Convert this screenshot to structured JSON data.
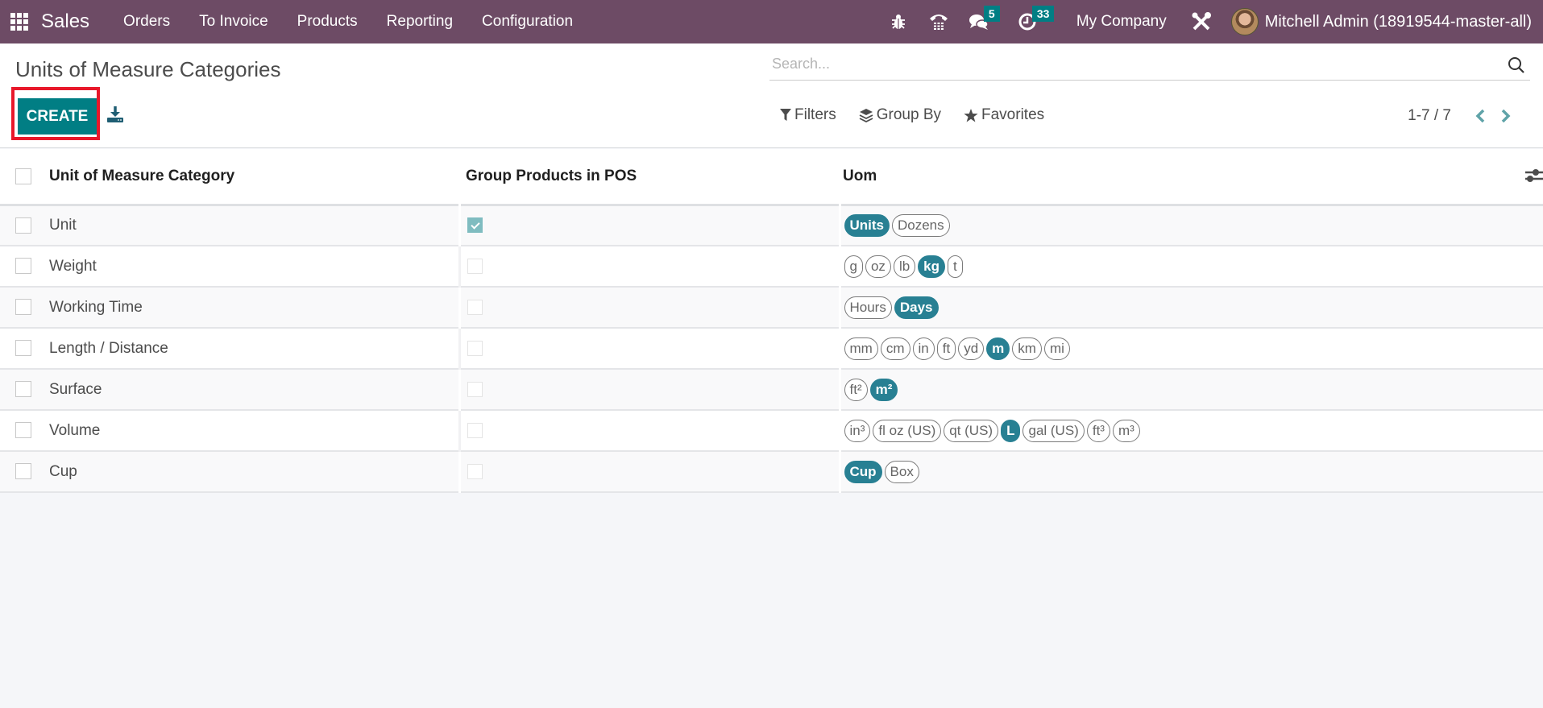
{
  "navbar": {
    "app_name": "Sales",
    "menu": [
      "Orders",
      "To Invoice",
      "Products",
      "Reporting",
      "Configuration"
    ],
    "icons": {
      "apps": "apps-grid-icon",
      "debug": "bug-icon",
      "phone": "phone-icon",
      "messages": "chat-icon",
      "activities": "clock-icon",
      "settings": "tools-icon"
    },
    "messages_count": "5",
    "activities_count": "33",
    "company": "My Company",
    "user": "Mitchell Admin (18919544-master-all)",
    "badge_color": "#017e84",
    "bar_color": "#6d4b65"
  },
  "control_panel": {
    "title": "Units of Measure Categories",
    "create_label": "CREATE",
    "create_highlight_color": "#e8182a",
    "search_placeholder": "Search...",
    "filters_label": "Filters",
    "group_by_label": "Group By",
    "favorites_label": "Favorites",
    "pager_value": "1-7 / 7",
    "accent_color": "#017e84"
  },
  "table": {
    "columns": [
      "Unit of Measure Category",
      "Group Products in POS",
      "Uom"
    ],
    "rows": [
      {
        "name": "Unit",
        "group_pos": true,
        "uoms": [
          {
            "label": "Units",
            "ref": true
          },
          {
            "label": "Dozens",
            "ref": false
          }
        ]
      },
      {
        "name": "Weight",
        "group_pos": false,
        "uoms": [
          {
            "label": "g",
            "ref": false
          },
          {
            "label": "oz",
            "ref": false
          },
          {
            "label": "lb",
            "ref": false
          },
          {
            "label": "kg",
            "ref": true
          },
          {
            "label": "t",
            "ref": false
          }
        ]
      },
      {
        "name": "Working Time",
        "group_pos": false,
        "uoms": [
          {
            "label": "Hours",
            "ref": false
          },
          {
            "label": "Days",
            "ref": true
          }
        ]
      },
      {
        "name": "Length / Distance",
        "group_pos": false,
        "uoms": [
          {
            "label": "mm",
            "ref": false
          },
          {
            "label": "cm",
            "ref": false
          },
          {
            "label": "in",
            "ref": false
          },
          {
            "label": "ft",
            "ref": false
          },
          {
            "label": "yd",
            "ref": false
          },
          {
            "label": "m",
            "ref": true
          },
          {
            "label": "km",
            "ref": false
          },
          {
            "label": "mi",
            "ref": false
          }
        ]
      },
      {
        "name": "Surface",
        "group_pos": false,
        "uoms": [
          {
            "label": "ft²",
            "ref": false
          },
          {
            "label": "m²",
            "ref": true
          }
        ]
      },
      {
        "name": "Volume",
        "group_pos": false,
        "uoms": [
          {
            "label": "in³",
            "ref": false
          },
          {
            "label": "fl oz (US)",
            "ref": false
          },
          {
            "label": "qt (US)",
            "ref": false
          },
          {
            "label": "L",
            "ref": true
          },
          {
            "label": "gal (US)",
            "ref": false
          },
          {
            "label": "ft³",
            "ref": false
          },
          {
            "label": "m³",
            "ref": false
          }
        ]
      },
      {
        "name": "Cup",
        "group_pos": false,
        "uoms": [
          {
            "label": "Cup",
            "ref": true
          },
          {
            "label": "Box",
            "ref": false
          }
        ]
      }
    ],
    "ref_tag_color": "#288093"
  }
}
